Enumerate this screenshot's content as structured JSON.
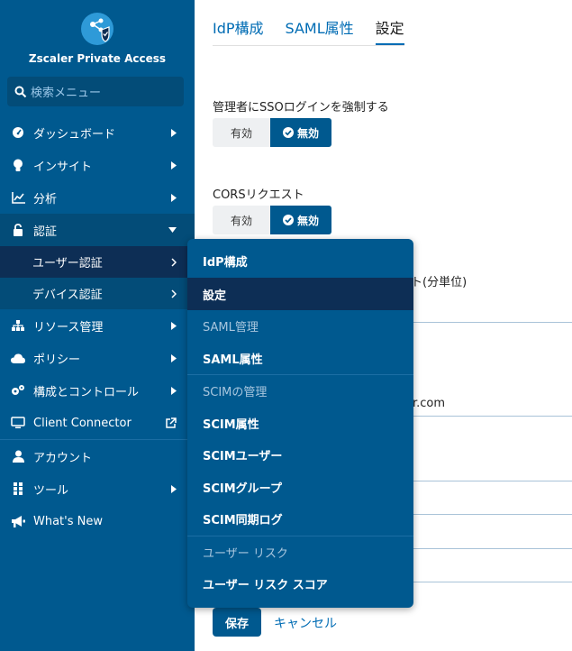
{
  "app": {
    "name": "Zscaler Private Access"
  },
  "search": {
    "placeholder": "検索メニュー"
  },
  "nav": {
    "items": [
      {
        "label": "ダッシュボード",
        "icon": "gauge-icon"
      },
      {
        "label": "インサイト",
        "icon": "lightbulb-icon"
      },
      {
        "label": "分析",
        "icon": "line-chart-icon"
      },
      {
        "label": "認証",
        "icon": "lock-icon"
      },
      {
        "label": "ユーザー認証"
      },
      {
        "label": "デバイス認証"
      },
      {
        "label": "リソース管理",
        "icon": "sitemap-icon"
      },
      {
        "label": "ポリシー",
        "icon": "cloud-icon"
      },
      {
        "label": "構成とコントロール",
        "icon": "gears-icon"
      },
      {
        "label": "Client Connector",
        "icon": "monitor-icon"
      },
      {
        "label": "アカウント",
        "icon": "user-icon"
      },
      {
        "label": "ツール",
        "icon": "grid-icon"
      },
      {
        "label": "What's New",
        "icon": "megaphone-icon"
      }
    ]
  },
  "tabs": [
    {
      "label": "IdP構成"
    },
    {
      "label": "SAML属性"
    },
    {
      "label": "設定",
      "active": true
    }
  ],
  "settings": {
    "sso_label": "管理者にSSOログインを強制する",
    "sso_off": "有効",
    "sso_on": "無効",
    "cors_label": "CORSリクエスト",
    "cors_off": "有効",
    "cors_on": "無効",
    "partial_label": "ト(分単位)",
    "partial_value": "r.com"
  },
  "actions": {
    "save": "保存",
    "cancel": "キャンセル"
  },
  "flyout": {
    "items": [
      {
        "label": "IdP構成",
        "type": "item"
      },
      {
        "label": "設定",
        "type": "item",
        "active": true
      },
      {
        "label": "SAML管理",
        "type": "header"
      },
      {
        "label": "SAML属性",
        "type": "item"
      },
      {
        "label": "SCIMの管理",
        "type": "header"
      },
      {
        "label": "SCIM属性",
        "type": "item"
      },
      {
        "label": "SCIMユーザー",
        "type": "item"
      },
      {
        "label": "SCIMグループ",
        "type": "item"
      },
      {
        "label": "SCIM同期ログ",
        "type": "item"
      },
      {
        "label": "ユーザー リスク",
        "type": "header"
      },
      {
        "label": "ユーザー リスク スコア",
        "type": "item"
      }
    ]
  },
  "colors": {
    "sidebar": "#00598f",
    "active_dark": "#0d2e55",
    "accent": "#006cb4"
  }
}
